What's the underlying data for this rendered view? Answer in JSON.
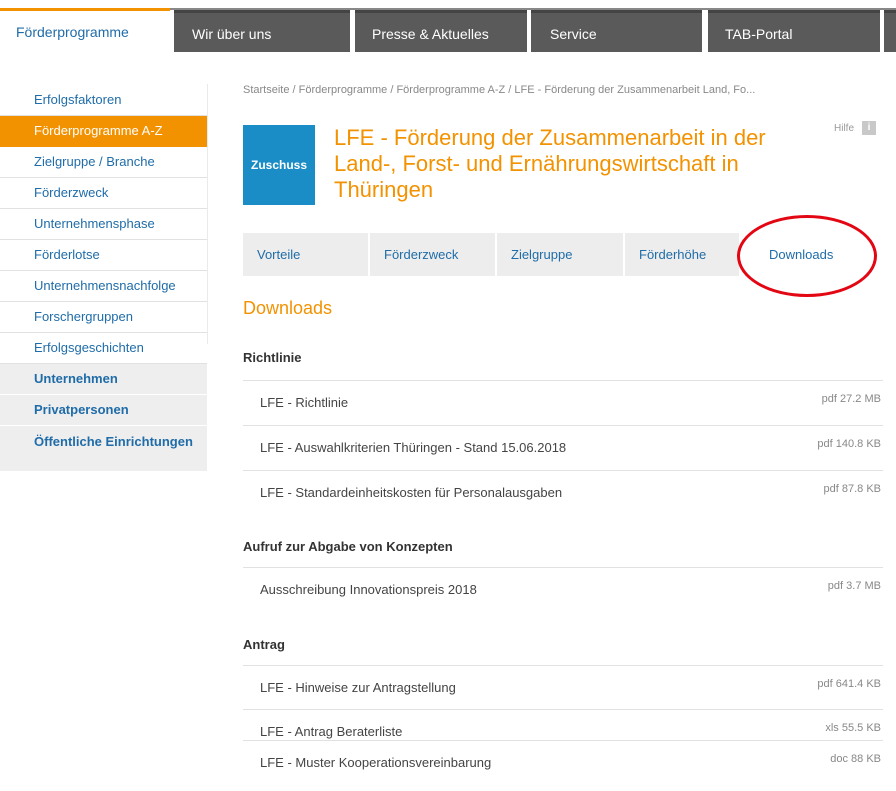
{
  "topnav": {
    "tabs": [
      {
        "label": "Förderprogramme"
      },
      {
        "label": "Wir über uns"
      },
      {
        "label": "Presse & Aktuelles"
      },
      {
        "label": "Service"
      },
      {
        "label": "TAB-Portal"
      }
    ]
  },
  "sidebar": {
    "items": [
      {
        "label": "Erfolgsfaktoren"
      },
      {
        "label": "Förderprogramme A-Z"
      },
      {
        "label": "Zielgruppe / Branche"
      },
      {
        "label": "Förderzweck"
      },
      {
        "label": "Unternehmensphase"
      },
      {
        "label": "Förderlotse"
      },
      {
        "label": "Unternehmensnachfolge"
      },
      {
        "label": "Forschergruppen"
      },
      {
        "label": "Erfolgsgeschichten"
      }
    ],
    "sections": [
      {
        "label": "Unternehmen"
      },
      {
        "label": "Privatpersonen"
      },
      {
        "label": "Öffentliche Einrichtungen"
      }
    ],
    "active_color": "#f39200"
  },
  "breadcrumb": "Startseite / Förderprogramme / Förderprogramme A-Z / LFE - Förderung der Zusammenarbeit Land, Fo...",
  "badge": {
    "label": "Zuschuss",
    "color": "#1a8cc6"
  },
  "page_title": "LFE - Förderung der Zusammenarbeit in der Land-, Forst- und Ernährungswirtschaft in Thüringen",
  "help_label": "Hilfe",
  "help_icon": "i",
  "tabs": [
    {
      "label": "Vorteile"
    },
    {
      "label": "Förderzweck"
    },
    {
      "label": "Zielgruppe"
    },
    {
      "label": "Förderhöhe"
    },
    {
      "label": "Downloads"
    }
  ],
  "section_title": "Downloads",
  "groups": [
    {
      "title": "Richtlinie",
      "files": [
        {
          "name": "LFE - Richtlinie",
          "meta": "pdf 27.2 MB"
        },
        {
          "name": "LFE - Auswahlkriterien Thüringen - Stand 15.06.2018",
          "meta": "pdf 140.8 KB"
        },
        {
          "name": "LFE - Standardeinheitskosten für Personalausgaben",
          "meta": "pdf 87.8 KB"
        }
      ]
    },
    {
      "title": "Aufruf zur Abgabe von Konzepten",
      "files": [
        {
          "name": "Ausschreibung Innovationspreis 2018",
          "meta": "pdf 3.7 MB"
        }
      ]
    },
    {
      "title": "Antrag",
      "files": [
        {
          "name": "LFE - Hinweise zur Antragstellung",
          "meta": "pdf 641.4 KB"
        },
        {
          "name": "LFE - Antrag Beraterliste",
          "meta": "xls 55.5 KB"
        },
        {
          "name": "LFE - Muster Kooperationsvereinbarung",
          "meta": "doc 88 KB"
        }
      ]
    }
  ],
  "colors": {
    "accent": "#f39200",
    "link": "#1f6ca8",
    "annotation": "#e30613"
  }
}
